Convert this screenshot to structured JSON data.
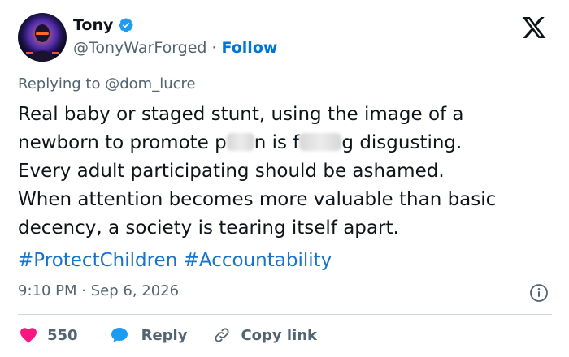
{
  "author": {
    "display_name": "Tony",
    "handle": "@TonyWarForged",
    "separator": "·",
    "follow_label": "Follow"
  },
  "reply_context": {
    "prefix": "Replying to",
    "mention": "@dom_lucre"
  },
  "tweet": {
    "lines": [
      {
        "text": "Real baby or staged stunt, using the image of a"
      },
      {
        "pre": "newborn to promote p",
        "mid": "n is f",
        "post": "g disgusting."
      },
      {
        "text": "Every adult participating should be ashamed."
      },
      {
        "text": "When attention becomes more valuable than basic"
      },
      {
        "text": "decency, a society is tearing itself apart."
      }
    ],
    "hashtags": [
      "#ProtectChildren",
      "#Accountability"
    ]
  },
  "meta": {
    "time": "9:10 PM",
    "separator": "·",
    "date": "Sep 6, 2026"
  },
  "actions": {
    "like_count": "550",
    "reply_label": "Reply",
    "copy_label": "Copy link"
  },
  "colors": {
    "text_primary": "#0f1419",
    "text_secondary": "#536471",
    "link_blue": "#1773cf",
    "verified_blue": "#1d9bf0",
    "like_pink": "#f91880",
    "divider": "#cfd9de"
  },
  "icons": {
    "verified": "verified-badge-icon",
    "platform": "x-logo-icon",
    "info": "info-icon",
    "like": "heart-icon",
    "reply": "speech-bubble-icon",
    "copy": "link-icon"
  }
}
